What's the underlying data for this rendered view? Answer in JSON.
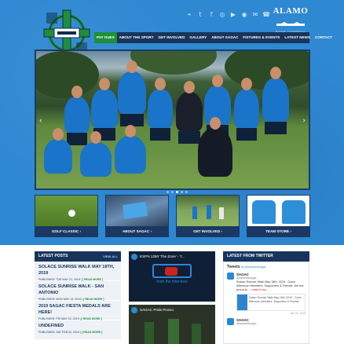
{
  "header": {
    "social_icons": [
      "location-icon",
      "twitter-icon",
      "facebook-icon",
      "instagram-icon",
      "youtube-icon",
      "map-icon",
      "mail-icon",
      "phone-icon"
    ],
    "social_glyphs": [
      "⌖",
      "t",
      "f",
      "◎",
      "▶",
      "◉",
      "✉",
      "☎"
    ],
    "sponsor": {
      "name": "ALAMO",
      "sub": "BEER COMPANY"
    }
  },
  "nav": {
    "items": [
      "PAY DUES",
      "ABOUT THE SPORT",
      "GET INVOLVED",
      "GALLERY",
      "ABOUT SAGAC",
      "FIXTURES & EVENTS",
      "LATEST NEWS",
      "CONTACT"
    ],
    "active_index": 0
  },
  "slider": {
    "prev": "‹",
    "next": "›",
    "dot_count": 5,
    "active_dot": 2
  },
  "tiles": [
    {
      "label": "GOLF CLASSIC ›"
    },
    {
      "label": "ABOUT SAGAC ›"
    },
    {
      "label": "GET INVOLVED ›"
    },
    {
      "label": "TEAM STORE ›"
    }
  ],
  "latest_posts": {
    "title": "LATEST POSTS",
    "view_all": "VIEW ALL",
    "posts": [
      {
        "title": "SOLACE SUNRISE WALK MAY 18TH, 2019",
        "meta": "PUBLISHED: TUE MAY 21, 2019 | ",
        "more": "[ READ MORE ]"
      },
      {
        "title": "SOLACE SUNRISE WALK - SAN ANTONIO",
        "meta": "PUBLISHED: MON MAY 13, 2019 | ",
        "more": "[ READ MORE ]"
      },
      {
        "title": "2019 SAGAC FIESTA MEDALS ARE HERE!",
        "meta": "PUBLISHED: FRI MAY 03, 2019 | ",
        "more": "[ READ MORE ]"
      },
      {
        "title": "UNDEFINED",
        "meta": "PUBLISHED: SAT FEB 02, 2019 | ",
        "more": "[ READ MORE ]"
      }
    ]
  },
  "videos": [
    {
      "title": "ESPN 1250 'The Zone' - T...",
      "caption": "from the interview"
    },
    {
      "title": "SAGAC Pride Promo",
      "caption": ""
    }
  ],
  "twitter": {
    "title": "LATEST FROM TWITTER",
    "heading": "Tweets",
    "by": "by @sanantoniogac",
    "tweets": [
      {
        "name": "SAGAC",
        "handle": "@sanantoniogac",
        "text": "Solace Sunrise Walk May 18th, 2019 - Good Afternoon Members, Supporters & Friends, We are proud to ... ",
        "link": "mailchi.mp/...",
        "card": "Solace Sunrise Walk May 18th, 2019 - Good Afternoon Members, Supporters & Friends.",
        "date": "Apr 20, 2019"
      },
      {
        "name": "SAGAC",
        "handle": "@sanantoniogac",
        "text": "",
        "link": "",
        "card": "",
        "date": ""
      }
    ]
  }
}
